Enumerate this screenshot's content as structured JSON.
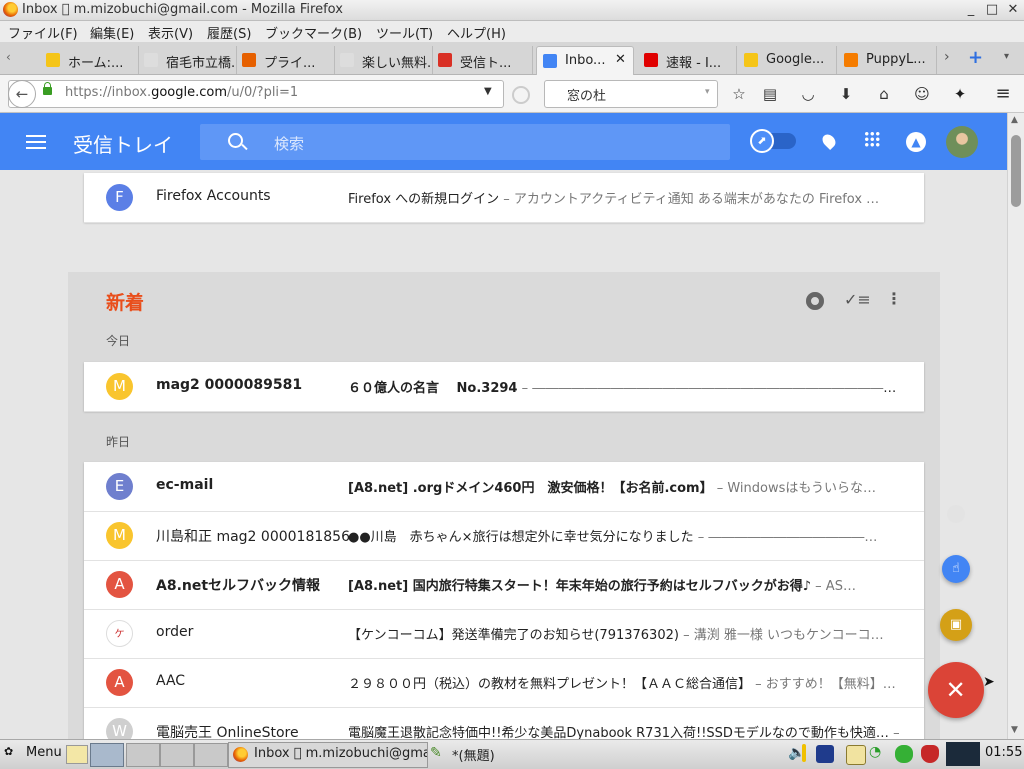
{
  "window": {
    "title": "Inbox \u0000 m.mizobuchi@gmail.com - Mozilla Firefox",
    "minimize": "_",
    "maximize": "□",
    "close": "✕"
  },
  "menu": [
    "ファイル(F)",
    "編集(E)",
    "表示(V)",
    "履歴(S)",
    "ブックマーク(B)",
    "ツール(T)",
    "ヘルプ(H)"
  ],
  "tabs": [
    {
      "label": "ホーム:...",
      "color": "#f5c518"
    },
    {
      "label": "宿毛市立橋...",
      "color": "#dddddd"
    },
    {
      "label": "プライ...",
      "color": "#e66000"
    },
    {
      "label": "楽しい無料...",
      "color": "#dddddd"
    },
    {
      "label": "受信ト...",
      "color": "#d93025"
    },
    {
      "label": "Inbo...",
      "color": "#4285f4",
      "active": true
    },
    {
      "label": "速報 - I...",
      "color": "#e00000"
    },
    {
      "label": "Google...",
      "color": "#f5c518"
    },
    {
      "label": "PuppyL...",
      "color": "#f57c00"
    }
  ],
  "nav": {
    "url_prefix": "https://inbox.",
    "url_domain": "google.com",
    "url_suffix": "/u/0/?pli=1",
    "search_engine_text": "窓の杜"
  },
  "inbox": {
    "title": "受信トレイ",
    "search_placeholder": "検索"
  },
  "top_item": {
    "avatar": "F",
    "avatar_color": "#5b7fe6",
    "sender": "Firefox Accounts",
    "subject": "Firefox への新規ログイン",
    "snippet": " – アカウントアクティビティ通知 ある端末があなたの Firefox …"
  },
  "bundle": {
    "title": "新着",
    "today_label": "今日",
    "yesterday_label": "昨日",
    "today": [
      {
        "avatar": "M",
        "avatar_color": "#f9c52e",
        "sender": "mag2 0000089581",
        "subject": "６０億人の名言　 No.3294",
        "snippet": " – ――――――――――――――――――――――――――――――――…",
        "unread": true
      }
    ],
    "yesterday": [
      {
        "avatar": "E",
        "avatar_color": "#6f7fce",
        "sender": "ec-mail",
        "subject": "[A8.net] .orgドメイン460円　激安価格！【お名前.com】",
        "snippet": " – Windowsはもういらな…",
        "unread": true
      },
      {
        "avatar": "M",
        "avatar_color": "#f9c52e",
        "sender": "川島和正 mag2 0000181856",
        "subject": "●●川島　赤ちゃん×旅行は想定外に幸せ気分になりました",
        "snippet": " – ――――――――――――…",
        "unread": false
      },
      {
        "avatar": "A",
        "avatar_color": "#e35441",
        "sender": "A8.netセルフバック情報",
        "subject": "[A8.net] 国内旅行特集スタート！年末年始の旅行予約はセルフバックがお得♪",
        "snippet": " – AS…",
        "unread": true
      },
      {
        "avatar": "ケ",
        "avatar_color": "#ffffff",
        "sender": "order",
        "subject": "【ケンコーコム】発送準備完了のお知らせ(791376302)",
        "snippet": " – 溝渕 雅一様 いつもケンコーコ…",
        "unread": false
      },
      {
        "avatar": "A",
        "avatar_color": "#e35441",
        "sender": "AAC",
        "subject": "２９８００円（税込）の教材を無料プレゼント！【ＡＡＣ総合通信】",
        "snippet": " – おすすめ！【無料】…",
        "unread": false
      },
      {
        "avatar": "W",
        "avatar_color": "#cfcfcf",
        "sender": "電脳売王 OnlineStore",
        "subject": "電脳魔王退散記念特価中!!希少な美品Dynabook R731入荷!!SSDモデルなので動作も快適…",
        "snippet": " –",
        "unread": false
      }
    ]
  },
  "fab": {
    "compose": "+",
    "compose_color": "#db4437",
    "reminder_color": "#4285f4",
    "event_color": "#d4a017"
  },
  "taskbar": {
    "menu_label": "Menu",
    "firefox_task": "Inbox \u0000 m.mizobuchi@gmai",
    "editor_task": "*(無題)",
    "clock": "01:55"
  }
}
